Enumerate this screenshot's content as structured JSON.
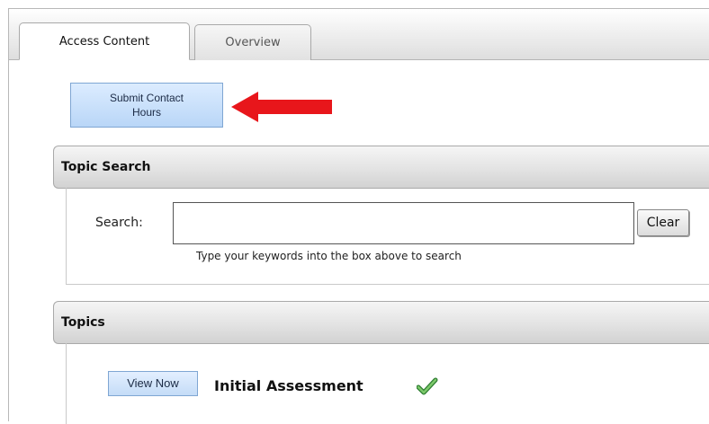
{
  "tabs": [
    {
      "label": "Access Content",
      "active": true
    },
    {
      "label": "Overview",
      "active": false
    }
  ],
  "submit_button": {
    "line1": "Submit Contact",
    "line2": "Hours"
  },
  "annotation": {
    "arrow_color": "#e8161b"
  },
  "topic_search": {
    "title": "Topic Search",
    "search_label": "Search:",
    "search_value": "",
    "clear_label": "Clear",
    "hint": "Type your keywords into the box above to search"
  },
  "topics": {
    "title": "Topics",
    "items": [
      {
        "button_label": "View Now",
        "title": "Initial Assessment",
        "status_icon": "check-icon",
        "completed": true
      }
    ]
  },
  "colors": {
    "button_blue": "#c4dcf7",
    "check_green": "#4caf3f"
  }
}
